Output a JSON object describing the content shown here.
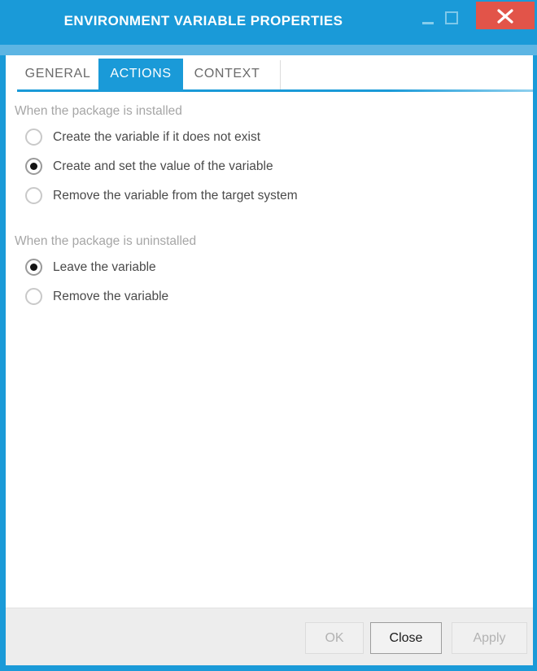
{
  "window": {
    "title": "ENVIRONMENT VARIABLE PROPERTIES",
    "accent_color": "#1a9ad8",
    "band_color": "#5db5e3",
    "close_color": "#e25449",
    "controls": {
      "minimize": "minimize-icon",
      "maximize": "maximize-icon",
      "close": "close-icon"
    }
  },
  "tabs": [
    {
      "label": "GENERAL",
      "active": false
    },
    {
      "label": "ACTIONS",
      "active": true
    },
    {
      "label": "CONTEXT",
      "active": false
    }
  ],
  "groups": [
    {
      "heading": "When the package is installed",
      "options": [
        {
          "label": "Create the variable if it does not exist",
          "selected": false
        },
        {
          "label": "Create and set the value of the variable",
          "selected": true
        },
        {
          "label": "Remove the variable from the target system",
          "selected": false
        }
      ]
    },
    {
      "heading": "When the package is uninstalled",
      "options": [
        {
          "label": "Leave the variable",
          "selected": true
        },
        {
          "label": "Remove the variable",
          "selected": false
        }
      ]
    }
  ],
  "footer": {
    "ok_label": "OK",
    "close_label": "Close",
    "apply_label": "Apply",
    "ok_enabled": false,
    "close_enabled": true,
    "apply_enabled": false
  }
}
